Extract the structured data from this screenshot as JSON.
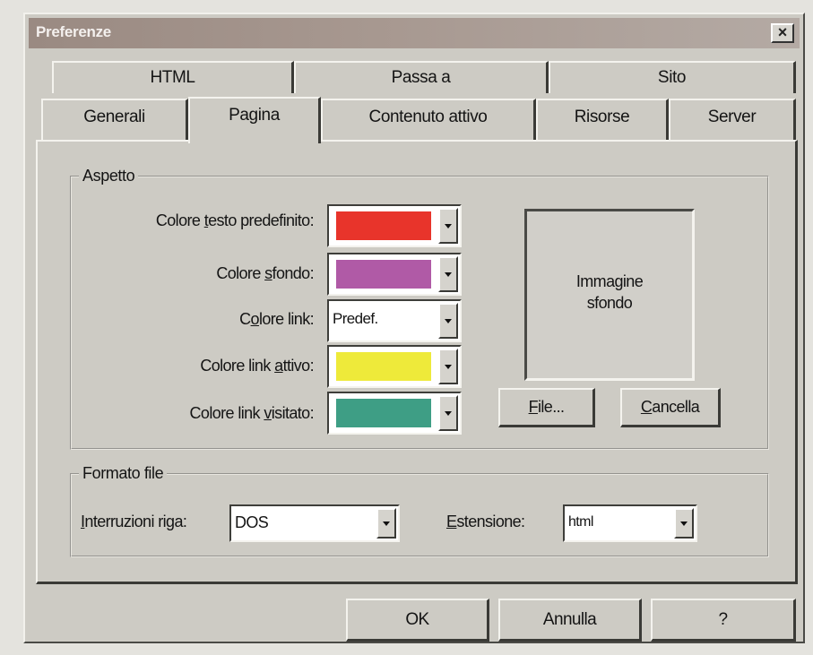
{
  "window": {
    "title": "Preferenze",
    "close_glyph": "×"
  },
  "tabs_row1": [
    "HTML",
    "Passa a",
    "Sito"
  ],
  "tabs_row2": [
    "Generali",
    "Pagina",
    "Contenuto attivo",
    "Risorse",
    "Server"
  ],
  "active_tab": "Pagina",
  "aspetto": {
    "legend": "Aspetto",
    "rows": [
      {
        "label_pre": "Colore ",
        "label_u": "t",
        "label_post": "esto predefinito:",
        "color": "#e8342b"
      },
      {
        "label_pre": "Colore ",
        "label_u": "s",
        "label_post": "fondo:",
        "color": "#b05aa6"
      },
      {
        "label_pre": "C",
        "label_u": "o",
        "label_post": "lore link:",
        "value": "Predef."
      },
      {
        "label_pre": "Colore link ",
        "label_u": "a",
        "label_post": "ttivo:",
        "color": "#eeea3a"
      },
      {
        "label_pre": "Colore link ",
        "label_u": "v",
        "label_post": "isitato:",
        "color": "#3e9e85"
      }
    ],
    "preview_label": "Immagine\nsfondo",
    "file_button": {
      "u": "F",
      "rest": "ile..."
    },
    "cancella_button": {
      "u": "C",
      "rest": "ancella"
    }
  },
  "formato": {
    "legend": "Formato file",
    "interruzioni_label": {
      "u": "I",
      "rest": "nterruzioni riga:"
    },
    "interruzioni_value": "DOS",
    "estensione_label": {
      "u": "E",
      "rest": "stensione:"
    },
    "estensione_value": "html"
  },
  "buttons": {
    "ok": "OK",
    "annulla": "Annulla",
    "help": "?"
  }
}
